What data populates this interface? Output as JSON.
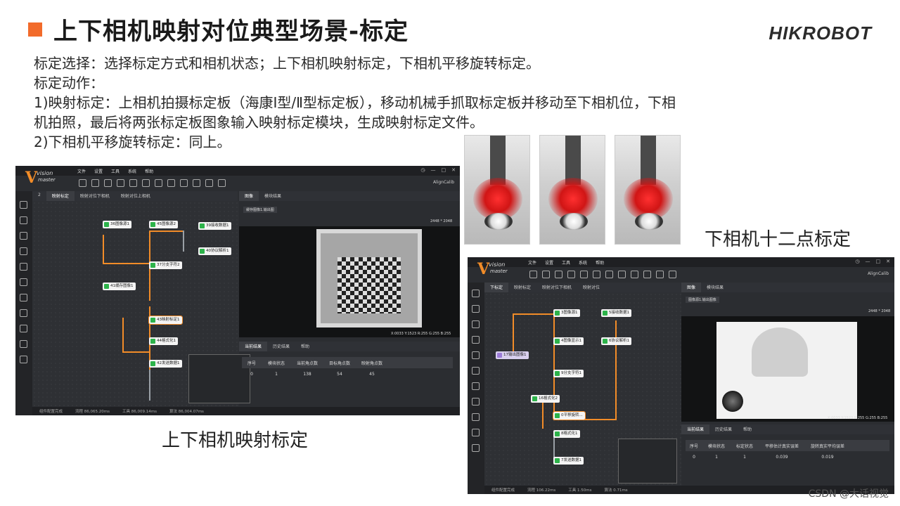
{
  "slide": {
    "title": "上下相机映射对位典型场景-标定",
    "brand": "HIKROBOT",
    "lines": [
      "标定选择：选择标定方式和相机状态；上下相机映射标定，下相机平移旋转标定。",
      "标定动作：",
      "1)映射标定：上相机拍摄标定板（海康Ⅰ型/Ⅱ型标定板），移动机械手抓取标定板并移动至下相机位，下相",
      "机拍照，最后将两张标定板图象输入映射标定模块，生成映射标定文件。",
      "2)下相机平移旋转标定：同上。"
    ],
    "caption_left": "上下相机映射标定",
    "caption_right": "下相机十二点标定",
    "watermark": "CSDN @大话视觉"
  },
  "app1": {
    "logo_top": "vision",
    "logo_bottom": "master",
    "menus": [
      "文件",
      "设置",
      "工具",
      "系统",
      "帮助"
    ],
    "aligncalib": "AlignCalib",
    "tabs": [
      "2",
      "映射标定",
      "映射对位下相机",
      "映射对位上相机"
    ],
    "nodes": [
      "36图像源1",
      "45图像源2",
      "39接收数据1",
      "40协议解析1",
      "37分支字符2",
      "41缓存图像1",
      "43映射标定1",
      "44格式化1",
      "42发送数据1"
    ],
    "image_tabs": [
      "图像",
      "模块结果"
    ],
    "image_source": "缓存图像1.输出图",
    "resolution": "2448 * 2048",
    "pixel_info": "X:0033  Y:1523  R:255  G:255  B:255",
    "result_tabs": [
      "当前结果",
      "历史结果",
      "帮助"
    ],
    "table": {
      "headers": [
        "序号",
        "模块状态",
        "当前角点数",
        "目标角点数",
        "映射角点数"
      ],
      "rows": [
        [
          "0",
          "1",
          "138",
          "54",
          "45"
        ]
      ]
    },
    "status": [
      "组件配置完成",
      "流程 86,065.20ms",
      "工具 86,009.14ms",
      "算法 86,004.07ms"
    ]
  },
  "app2": {
    "logo_top": "vision",
    "logo_bottom": "master",
    "menus": [
      "文件",
      "设置",
      "工具",
      "系统",
      "帮助"
    ],
    "aligncalib": "AlignCalib",
    "tabs": [
      "下标定",
      "映射标定",
      "映射对位下相机",
      "映射对位"
    ],
    "nodes": [
      "3图像源1",
      "5接收数据1",
      "4图像显示1",
      "6协议解析1",
      "17输出图像1",
      "9分支字符1",
      "16格式化2",
      "0平移旋转...",
      "8格式化1",
      "7发送数据1"
    ],
    "image_tabs": [
      "图像",
      "模块结果"
    ],
    "image_source": "图像源1.输出图像",
    "resolution": "2448 * 2048",
    "pixel_info": "X:0033  Y:1523  R:255  G:255  B:255",
    "result_tabs": [
      "当前结果",
      "历史结果",
      "帮助"
    ],
    "table": {
      "headers": [
        "序号",
        "模块状态",
        "标定状态",
        "平移估计真实误差",
        "旋转真实平均误差"
      ],
      "rows": [
        [
          "0",
          "1",
          "1",
          "0.039",
          "0.019"
        ]
      ]
    },
    "status": [
      "组件配置完成",
      "流程 106.22ms",
      "工具 1.50ms",
      "算法 0.71ms"
    ]
  }
}
